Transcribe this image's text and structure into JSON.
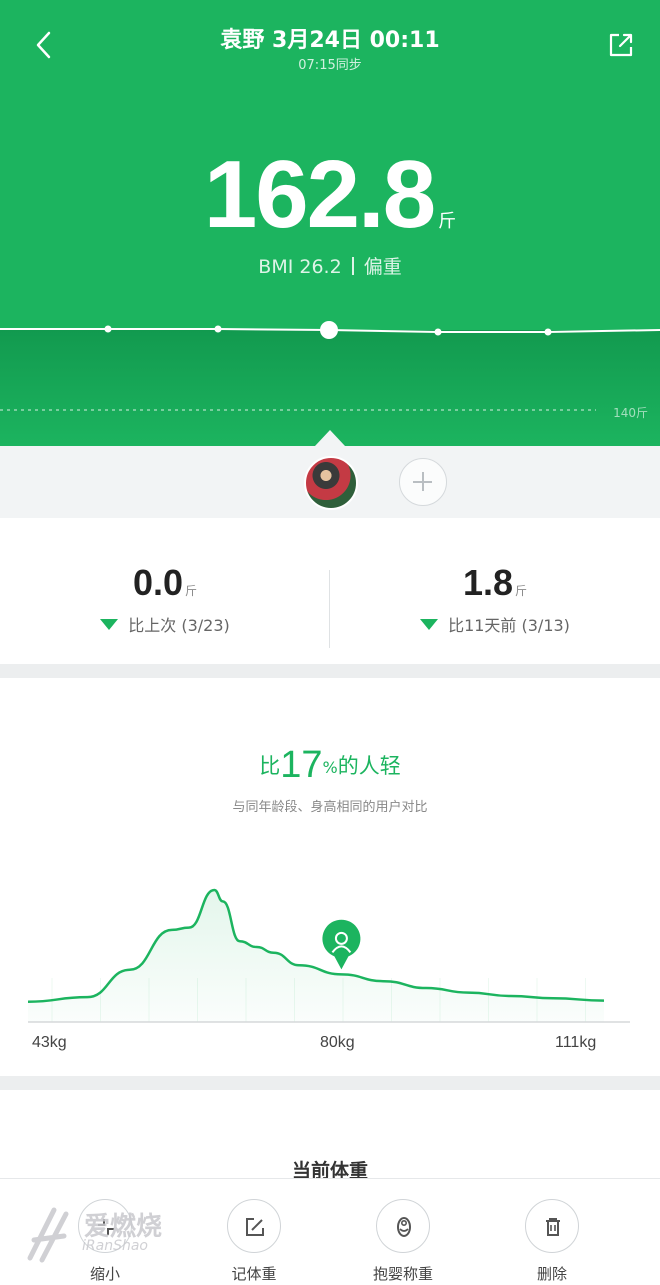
{
  "header": {
    "title": "袁野 3月24日 00:11",
    "sync_text": "07:15同步",
    "weight_value": "162.8",
    "weight_unit": "斤",
    "bmi_text": "BMI 26.2",
    "bmi_status": "偏重",
    "reference_label": "140斤"
  },
  "icons": {
    "back": "back-arrow-icon",
    "share": "share-icon",
    "add_user": "plus-icon",
    "user_pin": "user-pin-icon",
    "collapse": "collapse-icon",
    "log_weight": "edit-icon",
    "baby": "baby-icon",
    "delete": "trash-icon"
  },
  "comparison": {
    "left": {
      "value": "0.0",
      "unit": "斤",
      "label": "比上次 (3/23)"
    },
    "right": {
      "value": "1.8",
      "unit": "斤",
      "label": "比11天前 (3/13)"
    }
  },
  "distribution": {
    "title_prefix": "比",
    "title_percent": "17",
    "title_pct_sign": "%",
    "title_suffix": "的人轻",
    "subtitle": "与同年龄段、身高相同的用户对比",
    "axis_min": "43kg",
    "axis_mid": "80kg",
    "axis_max": "111kg"
  },
  "current_section": {
    "title": "当前体重"
  },
  "toolbar": {
    "collapse_label": "缩小",
    "log_label": "记体重",
    "baby_label": "抱婴称重",
    "delete_label": "删除"
  },
  "watermark": {
    "text": "爱燃烧",
    "sub": "iRanShao"
  },
  "colors": {
    "accent": "#1cb45f",
    "accent_dark": "#129a4f",
    "strip": "#f2f4f5"
  },
  "chart_data": {
    "type": "area",
    "x_unit": "kg",
    "x_ticks": [
      "43kg",
      "80kg",
      "111kg"
    ],
    "xlim": [
      43,
      111
    ],
    "highlight_x": 80,
    "x": [
      43,
      50,
      55,
      60,
      62,
      65,
      66,
      68,
      70,
      72,
      75,
      80,
      85,
      90,
      95,
      100,
      105,
      111
    ],
    "y": [
      0.02,
      0.06,
      0.3,
      0.65,
      0.67,
      1.0,
      0.9,
      0.55,
      0.5,
      0.45,
      0.34,
      0.26,
      0.2,
      0.14,
      0.1,
      0.07,
      0.05,
      0.03
    ]
  }
}
